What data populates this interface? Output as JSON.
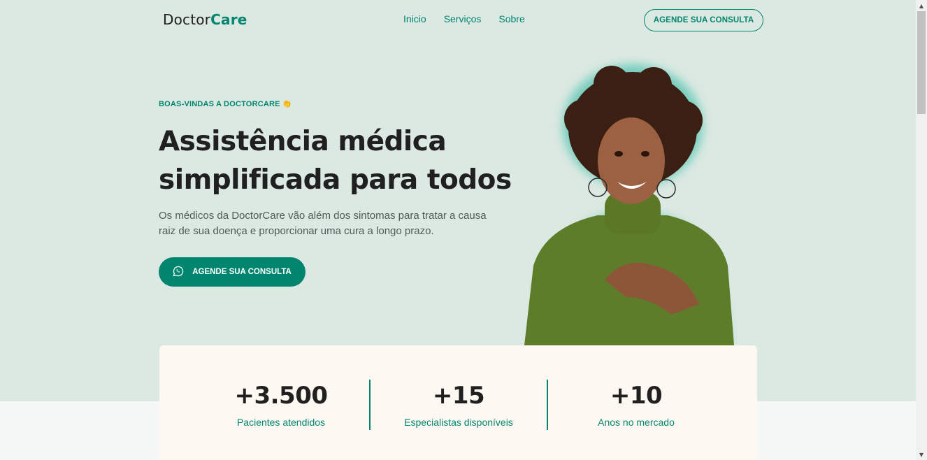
{
  "header": {
    "logo_text": "Doctor",
    "logo_brand": "Care",
    "nav": [
      "Inicio",
      "Serviços",
      "Sobre"
    ],
    "cta_label": "AGENDE SUA CONSULTA"
  },
  "hero": {
    "eyebrow": "BOAS-VINDAS A DOCTORCARE 👏",
    "title": "Assistência médica simplificada para todos",
    "description": "Os médicos da DoctorCare vão além dos sintomas para tratar a causa raiz de sua doença e proporcionar uma cura a longo prazo.",
    "cta_label": "AGENDE SUA CONSULTA",
    "cta_icon": "whatsapp-icon"
  },
  "stats": [
    {
      "value": "+3.500",
      "label": "Pacientes atendidos"
    },
    {
      "value": "+15",
      "label": "Especialistas disponíveis"
    },
    {
      "value": "+10",
      "label": "Anos no mercado"
    }
  ],
  "colors": {
    "primary": "#00856f",
    "hero_bg": "#dce9e2",
    "stats_bg": "#fdf9f2",
    "text": "#202020"
  }
}
